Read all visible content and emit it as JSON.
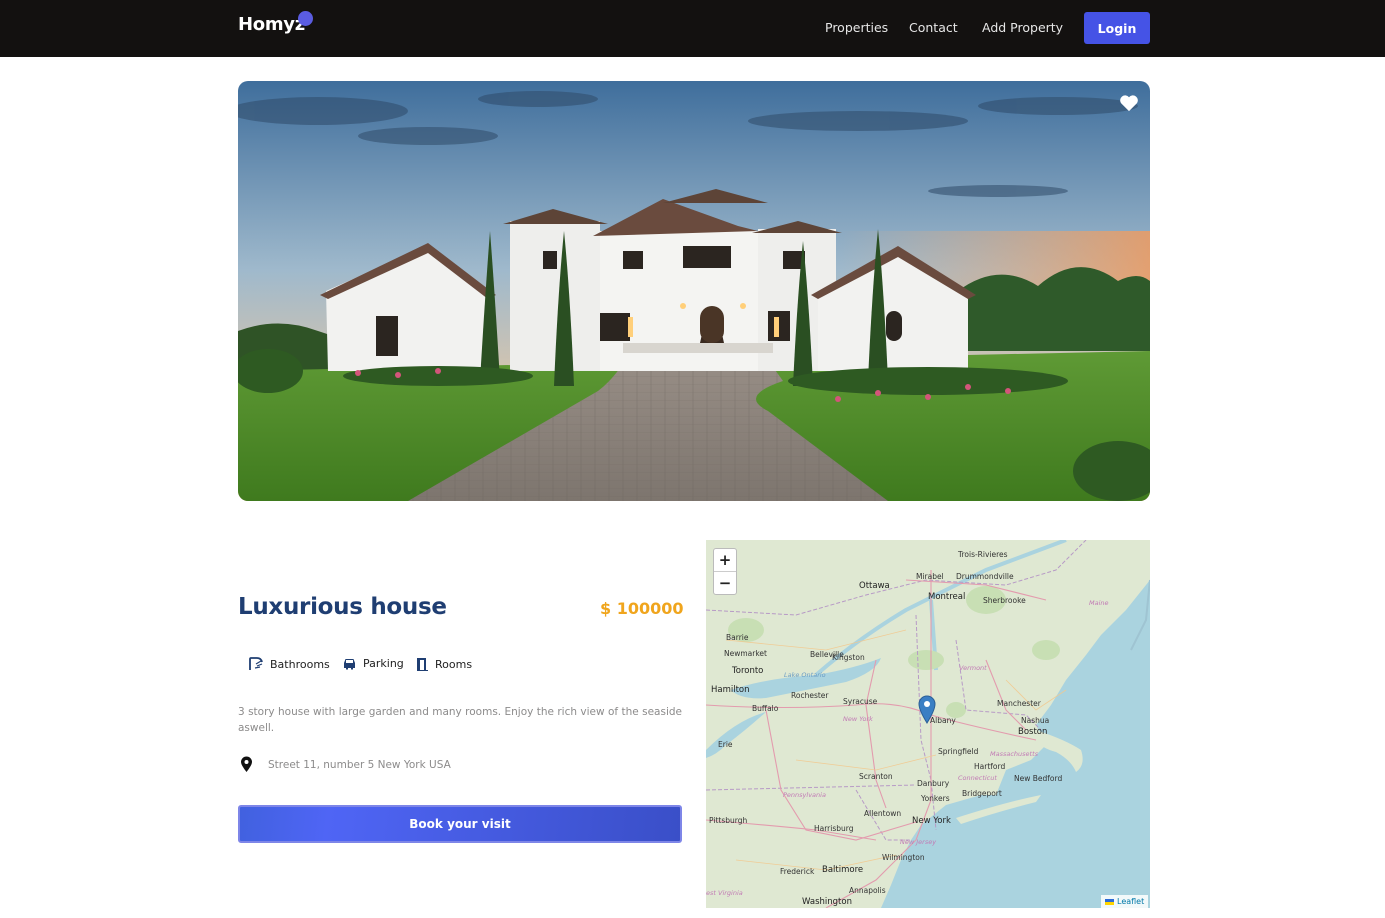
{
  "brand": {
    "name": "Homyz",
    "accent": "#5a5ce0"
  },
  "nav": {
    "items": [
      "Properties",
      "Contact",
      "Add Property"
    ],
    "login_label": "Login"
  },
  "hero": {
    "favorite_icon": "heart-icon",
    "image": "luxury-white-villa-at-sunset"
  },
  "property": {
    "title": "Luxurious house",
    "price": "$ 100000",
    "facilities": [
      {
        "icon": "shower-icon",
        "label": "Bathrooms"
      },
      {
        "icon": "car-icon",
        "label": "Parking"
      },
      {
        "icon": "door-icon",
        "label": "Rooms"
      }
    ],
    "description": "3 story house with large garden and many rooms. Enjoy the rich view of the seaside aswell.",
    "address": "Street 11, number 5 New York USA",
    "book_label": "Book your visit"
  },
  "map": {
    "zoom_in": "+",
    "zoom_out": "−",
    "attribution": "Leaflet",
    "labels": {
      "trois_rivieres": "Trois-Rivieres",
      "mirabel": "Mirabel",
      "drummondville": "Drummondville",
      "ottawa": "Ottawa",
      "montreal": "Montreal",
      "sherbrooke": "Sherbrooke",
      "maine": "Maine",
      "barrie": "Barrie",
      "newmarket": "Newmarket",
      "belleville": "Belleville",
      "kingston": "Kingston",
      "toronto": "Toronto",
      "vermont": "Vermont",
      "lake_ontario": "Lake Ontario",
      "hamilton": "Hamilton",
      "rochester": "Rochester",
      "buffalo": "Buffalo",
      "syracuse": "Syracuse",
      "new_york_state": "New York",
      "albany": "Albany",
      "manchester": "Manchester",
      "nashua": "Nashua",
      "boston": "Boston",
      "erie": "Erie",
      "springfield": "Springfield",
      "massachusetts": "Massachusetts",
      "hartford": "Hartford",
      "scranton": "Scranton",
      "connecticut": "Connecticut",
      "new_bedford": "New Bedford",
      "danbury": "Danbury",
      "pennsylvania": "Pennsylvania",
      "yonkers": "Yonkers",
      "bridgeport": "Bridgeport",
      "allentown": "Allentown",
      "pittsburgh": "Pittsburgh",
      "new_york_city": "New York",
      "harrisburg": "Harrisburg",
      "new_jersey": "New Jersey",
      "wilmington": "Wilmington",
      "frederick": "Frederick",
      "baltimore": "Baltimore",
      "annapolis": "Annapolis",
      "west_virginia": "est Virginia",
      "washington": "Washington"
    }
  }
}
